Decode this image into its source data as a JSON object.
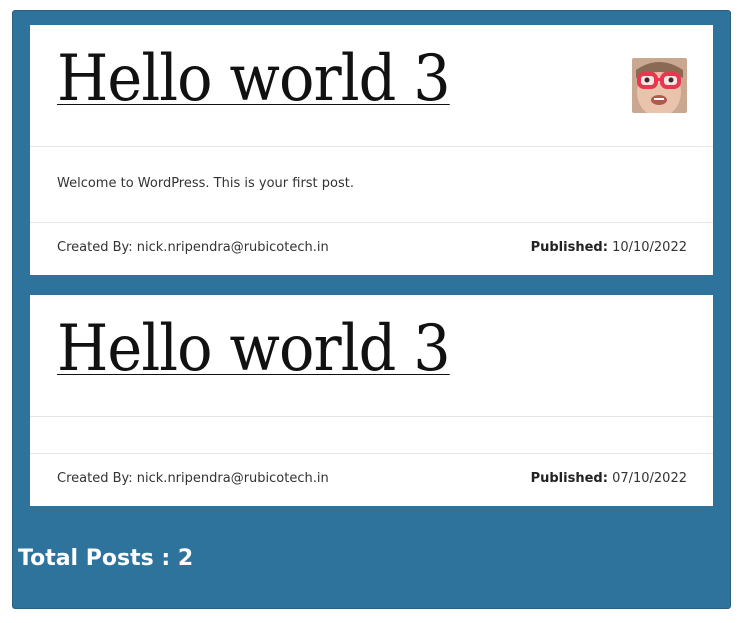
{
  "posts": [
    {
      "title": "Hello world 3",
      "content": "Welcome to WordPress. This is your first post.",
      "created_label": "Created By:",
      "author": "nick.nripendra@rubicotech.in",
      "published_label": "Published:",
      "published_date": "10/10/2022",
      "has_avatar": true
    },
    {
      "title": "Hello world 3",
      "content": "",
      "created_label": "Created By:",
      "author": "nick.nripendra@rubicotech.in",
      "published_label": "Published:",
      "published_date": "07/10/2022",
      "has_avatar": false
    }
  ],
  "summary": {
    "total_label": "Total Posts : 2"
  },
  "colors": {
    "panel_background": "#2e739c",
    "card_background": "#ffffff"
  }
}
